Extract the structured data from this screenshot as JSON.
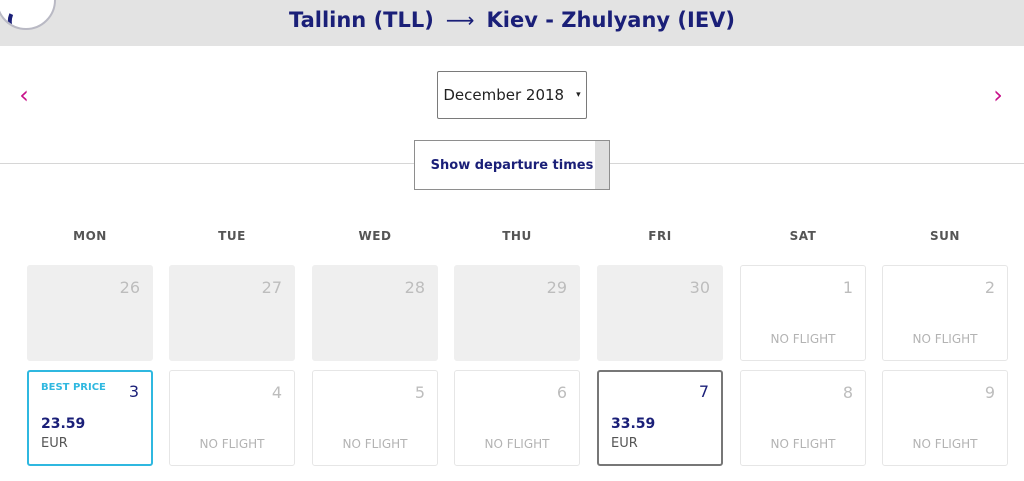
{
  "header": {
    "origin": "Tallinn (TLL)",
    "arrow": "⟶",
    "destination": "Kiev - Zhulyany (IEV)"
  },
  "nav": {
    "prev": "‹",
    "next": "›"
  },
  "month_select": {
    "value": "December 2018",
    "caret": "▾"
  },
  "departure_button": {
    "label": "Show departure times"
  },
  "weekdays": [
    "MON",
    "TUE",
    "WED",
    "THU",
    "FRI",
    "SAT",
    "SUN"
  ],
  "days": [
    {
      "day": "26",
      "state": "disabled"
    },
    {
      "day": "27",
      "state": "disabled"
    },
    {
      "day": "28",
      "state": "disabled"
    },
    {
      "day": "29",
      "state": "disabled"
    },
    {
      "day": "30",
      "state": "disabled"
    },
    {
      "day": "1",
      "state": "noflight",
      "label": "NO FLIGHT"
    },
    {
      "day": "2",
      "state": "noflight",
      "label": "NO FLIGHT"
    },
    {
      "day": "3",
      "state": "best",
      "badge": "BEST PRICE",
      "price": "23.59",
      "currency": "EUR"
    },
    {
      "day": "4",
      "state": "noflight",
      "label": "NO FLIGHT"
    },
    {
      "day": "5",
      "state": "noflight",
      "label": "NO FLIGHT"
    },
    {
      "day": "6",
      "state": "noflight",
      "label": "NO FLIGHT"
    },
    {
      "day": "7",
      "state": "priced",
      "price": "33.59",
      "currency": "EUR"
    },
    {
      "day": "8",
      "state": "noflight",
      "label": "NO FLIGHT"
    },
    {
      "day": "9",
      "state": "noflight",
      "label": "NO FLIGHT"
    }
  ],
  "colors": {
    "brand_navy": "#1a1f78",
    "accent_magenta": "#c8108a",
    "best_price_cyan": "#2fb8e0"
  }
}
